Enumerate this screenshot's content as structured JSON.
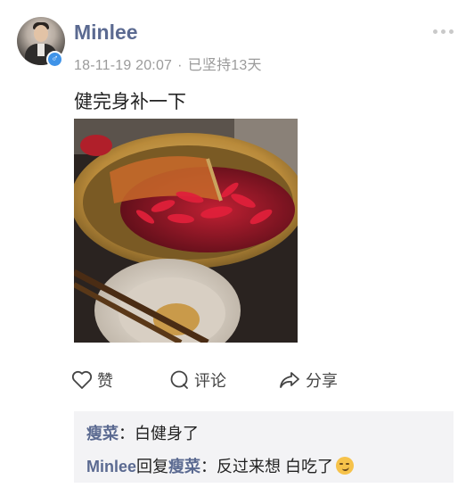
{
  "post": {
    "username": "Minlee",
    "gender_icon": "male-icon",
    "gender_symbol": "♂",
    "date": "18-11-19 20:07",
    "separator": "·",
    "streak": "已坚持13天",
    "text": "健完身补一下",
    "photo_icon": "hotpot-photo"
  },
  "actions": {
    "like_label": "赞",
    "comment_label": "评论",
    "share_label": "分享"
  },
  "comments": [
    {
      "author": "瘦菜",
      "colon": "：",
      "text": "白健身了"
    },
    {
      "author": "Minlee",
      "reply_word": "回复",
      "reply_to": "瘦菜",
      "colon": "：",
      "text": "反过来想 白吃了",
      "emoji": "smirk-emoji"
    }
  ],
  "colors": {
    "name": "#5b6a91",
    "meta": "#9b9b9b",
    "comment_bg": "#f3f3f5",
    "badge": "#3f93e8"
  }
}
